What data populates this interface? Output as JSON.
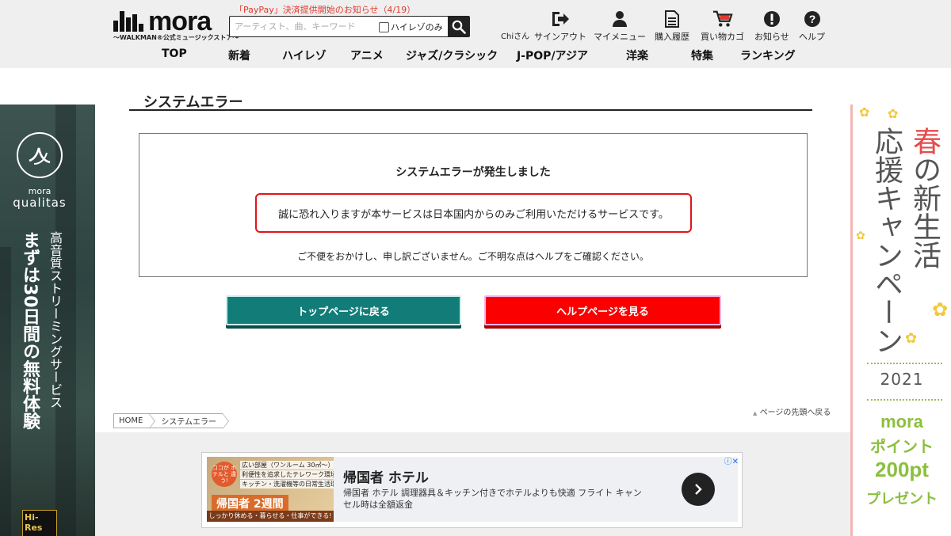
{
  "header": {
    "logo_text": "mora",
    "logo_sub": "〜WALKMAN®公式ミュージックストア〜",
    "news_link": "「PayPay」決済提供開始のお知らせ（4/19）",
    "search": {
      "placeholder": "アーティスト、曲、キーワード",
      "hires_only_label": "ハイレゾのみ"
    },
    "user_name": "Chiさん",
    "nav_icons": [
      {
        "label": "サインアウト",
        "icon": "signout-icon"
      },
      {
        "label": "マイメニュー",
        "icon": "user-icon"
      },
      {
        "label": "購入履歴",
        "icon": "document-icon"
      },
      {
        "label": "買い物カゴ",
        "icon": "cart-icon"
      },
      {
        "label": "お知らせ",
        "icon": "exclamation-icon"
      },
      {
        "label": "ヘルプ",
        "icon": "help-icon"
      }
    ],
    "global_nav": [
      "TOP",
      "新着",
      "ハイレゾ",
      "アニメ",
      "ジャズ/クラシック",
      "J-POP/アジア",
      "洋楽",
      "特集",
      "ランキング"
    ]
  },
  "left_banner": {
    "brand_small": "mora",
    "brand": "qualitas",
    "main_text": "まずは30日間の無料体験",
    "sub_text": "高音質ストリーミングサービス",
    "badge": "Hi-Res"
  },
  "right_banner": {
    "col1_accent": "春",
    "col1_rest": "の新生活",
    "col2": "応援キャンペーン",
    "year": "2021",
    "promo1": "mora",
    "promo2": "ポイント",
    "promo3": "200pt",
    "promo4": "プレゼント"
  },
  "main": {
    "page_title": "システムエラー",
    "error_heading": "システムエラーが発生しました",
    "error_message": "誠に恐れ入りますが本サービスは日本国内からのみご利用いただけるサービスです。",
    "error_note": "ご不便をおかけし、申し訳ございません。ご不明な点はヘルプをご確認ください。",
    "btn_top": "トップページに戻る",
    "btn_help": "ヘルプページを見る",
    "back_to_top": "ページの先頭へ戻る"
  },
  "breadcrumb": [
    "HOME",
    "システムエラー"
  ],
  "ad": {
    "title": "帰国者 ホテル",
    "description": "帰国者 ホテル 調理器具＆キッチン付きでホテルよりも快適 フライト キャンセル時は全額返金",
    "img_badge": "ココが ホテルと 違う!",
    "img_line1": "広い部屋（ワンルーム 30㎡〜）",
    "img_line2": "利便性を追求したテレワーク環境",
    "img_line3": "キッチン・洗濯機等の日常生活環境",
    "img_big": "帰国者 2週間",
    "img_foot": "しっかり休める・暮らせる・仕事ができる!"
  },
  "colors": {
    "teal_button": "#127c78",
    "red_button": "#fa0000",
    "alert_border": "#e0141c",
    "header_bg": "#efefef"
  }
}
